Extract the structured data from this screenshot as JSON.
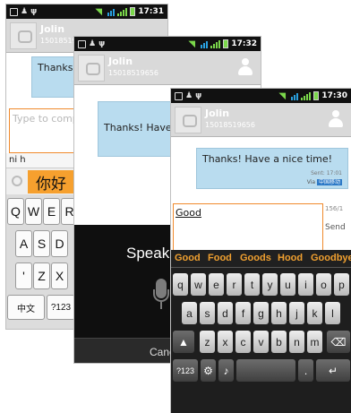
{
  "colors": {
    "accent": "#f08a2c",
    "bubble": "#b9dcef",
    "signal": "#7bd84b"
  },
  "screen1": {
    "time": "17:31",
    "contact_name": "Jolin",
    "contact_number": "15018519656",
    "message_preview": "Thanks!",
    "compose_placeholder": "Type to comp",
    "ime_pinyin": "ni h",
    "ime_candidate": "你好",
    "keys_row1": [
      "Q",
      "W",
      "E",
      "R"
    ],
    "keys_row2": [
      "A",
      "S",
      "D"
    ],
    "keys_row3": [
      "Z",
      "X"
    ],
    "key_lang": "中文",
    "key_sym": "?123"
  },
  "screen2": {
    "time": "17:32",
    "contact_name": "Jolin",
    "contact_number": "15018519656",
    "message_preview": "Thanks! Have a",
    "speak_prompt": "Speak",
    "cancel_label": "Cancel"
  },
  "screen3": {
    "time": "17:30",
    "contact_name": "Jolin",
    "contact_number": "15018519656",
    "message_text": "Thanks! Have a nice time!",
    "sent_text": "Sent: 17:01",
    "via_label": "Via",
    "via_network": "中国移动",
    "compose_text": "Good",
    "char_count": "156/1",
    "send_label": "Send",
    "suggestions": [
      "Good",
      "Food",
      "Goods",
      "Hood",
      "Goodbye"
    ],
    "keys_row1": [
      "q",
      "w",
      "e",
      "r",
      "t",
      "y",
      "u",
      "i",
      "o",
      "p"
    ],
    "keys_row2": [
      "a",
      "s",
      "d",
      "f",
      "g",
      "h",
      "j",
      "k",
      "l"
    ],
    "keys_row3": [
      "z",
      "x",
      "c",
      "v",
      "b",
      "n",
      "m"
    ],
    "key_sym": "?123",
    "key_dot": ".",
    "key_enter": "↵",
    "icons": [
      "shift-icon",
      "delete-icon",
      "settings-icon",
      "mic-icon"
    ]
  }
}
